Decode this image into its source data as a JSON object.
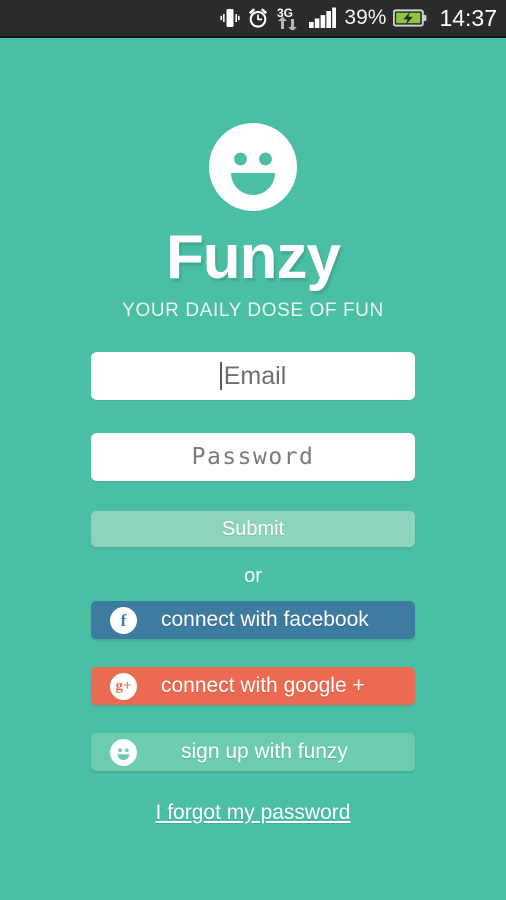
{
  "status_bar": {
    "icons": [
      {
        "name": "vibrate-icon"
      },
      {
        "name": "alarm-clock-icon"
      },
      {
        "name": "network-3g-icon",
        "label": "3G"
      },
      {
        "name": "signal-bars-icon"
      }
    ],
    "battery_percent": "39%",
    "battery_icon": "battery-charging-icon",
    "time": "14:37"
  },
  "brand": {
    "logo_icon": "smiley-face-logo",
    "title": "Funzy",
    "subtitle": "YOUR DAILY DOSE OF FUN"
  },
  "form": {
    "email": {
      "value": "",
      "placeholder": "Email"
    },
    "password": {
      "value": "",
      "placeholder": "Password"
    },
    "submit_label": "Submit",
    "divider_label": "or"
  },
  "social": [
    {
      "key": "facebook",
      "label": "connect with facebook",
      "icon": "facebook-icon",
      "glyph": "f",
      "color": "#3d7ba1"
    },
    {
      "key": "google",
      "label": "connect with google +",
      "icon": "google-plus-icon",
      "glyph": "g+",
      "color": "#ec6a52"
    },
    {
      "key": "funzy",
      "label": "sign up with funzy",
      "icon": "smiley-face-icon",
      "glyph": "",
      "color": "#6bccb1"
    }
  ],
  "forgot_password_label": "I forgot my password",
  "colors": {
    "background": "#4bbfa5",
    "submit": "#8fd3bf",
    "facebook": "#3d7ba1",
    "google": "#ec6a52",
    "funzy": "#6bccb1",
    "status_bar": "#2b2b2b",
    "battery_fill": "#8ec63f"
  }
}
